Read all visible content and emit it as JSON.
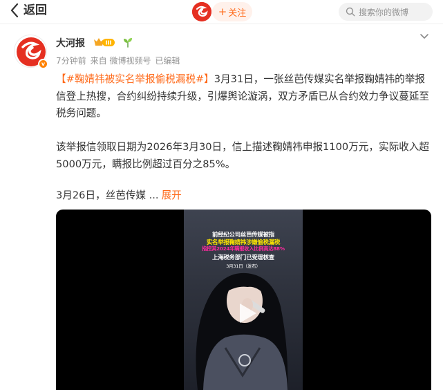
{
  "header": {
    "back_label": "返回",
    "follow_label": "关注",
    "search_placeholder": "搜索你的微博"
  },
  "post": {
    "author": "大河报",
    "meta": {
      "time": "7分钟前",
      "source": "来自 微博视频号",
      "edited": "已编辑"
    },
    "topic": "【#鞠婧祎被实名举报偷税漏税#】",
    "paragraph1": "3月31日，一张丝芭传媒实名举报鞠婧祎的举报信登上热搜，合约纠纷持续升级，引爆舆论漩涡，双方矛盾已从合约效力争议蔓延至税务问题。",
    "paragraph2": "该举报信领取日期为2026年3月30日，信上描述鞠婧祎申报1100万元，实际收入超5000万元，瞒报比例超过百分之85%。",
    "truncated": "3月26日，丝芭传媒 ...",
    "expand_label": "展开"
  },
  "video": {
    "caption_line1": "前经纪公司丝芭传媒被指",
    "caption_line2": "实名举报鞠婧祎涉嫌偷税漏税",
    "caption_line3": "指控其2024年瞒报收入比例高达88%",
    "caption_line4": "上海税务部门已受理核查",
    "caption_date": "3月31日（发布）"
  },
  "colors": {
    "accent": "#ff6a1a",
    "brand_red": "#e52f21",
    "text": "#333333",
    "meta": "#939393"
  },
  "icons": {
    "back": "chevron-left-icon",
    "search": "search-icon",
    "more": "chevron-down-icon",
    "play": "play-icon",
    "vip": "vip-badge-icon",
    "sprout": "sprout-icon"
  }
}
